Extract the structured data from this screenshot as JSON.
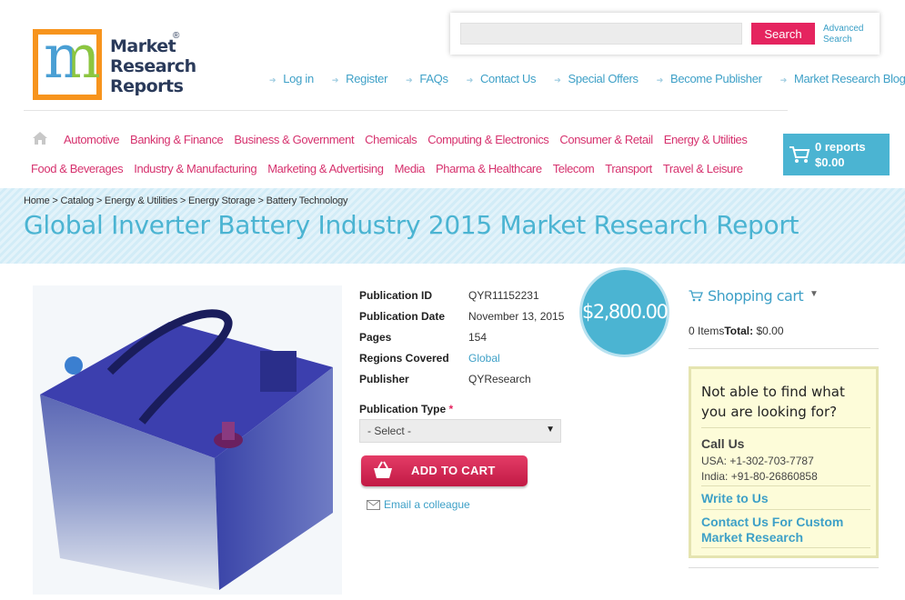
{
  "logo": {
    "line1": "Market",
    "line2": "Research",
    "line3": "Reports",
    "reg": "®",
    "letter": "m"
  },
  "search": {
    "placeholder": "",
    "button": "Search",
    "advanced": "Advanced Search"
  },
  "toplinks": [
    "Log in",
    "Register",
    "FAQs",
    "Contact Us",
    "Special Offers",
    "Become Publisher",
    "Market Research Blog"
  ],
  "categories_row1": [
    "Automotive",
    "Banking & Finance",
    "Business & Government",
    "Chemicals",
    "Computing & Electronics",
    "Consumer & Retail",
    "Energy & Utilities"
  ],
  "categories_row2": [
    "Food & Beverages",
    "Industry & Manufacturing",
    "Marketing & Advertising",
    "Media",
    "Pharma & Healthcare",
    "Telecom",
    "Transport",
    "Travel & Leisure"
  ],
  "cart": {
    "reports": "0 reports",
    "total": "$0.00"
  },
  "breadcrumb": "Home > Catalog > Energy & Utilities > Energy Storage > Battery Technology",
  "title": "Global Inverter Battery Industry 2015 Market Research Report",
  "details": {
    "rows": [
      {
        "label": "Publication ID",
        "value": "QYR11152231"
      },
      {
        "label": "Publication Date",
        "value": "November 13, 2015"
      },
      {
        "label": "Pages",
        "value": "154"
      },
      {
        "label": "Regions Covered",
        "value": "Global"
      },
      {
        "label": "Publisher",
        "value": "QYResearch"
      }
    ]
  },
  "price": "$2,800.00",
  "pubtype": {
    "label": "Publication Type",
    "required": "*",
    "selected": "- Select -"
  },
  "add_to_cart": "ADD TO CART",
  "email_colleague": "Email a colleague",
  "shopping_cart": {
    "title": "Shopping cart",
    "items": "0 Items",
    "total_label": "Total:",
    "total": "$0.00"
  },
  "help": {
    "title": "Not able to find what you are looking for?",
    "call_heading": "Call Us",
    "usa": "USA: +1-302-703-7787",
    "india": "India: +91-80-26860858",
    "write": "Write to Us",
    "custom": "Contact Us For Custom Market Research"
  },
  "colors": {
    "accent": "#4bb4d2",
    "pink": "#e5245f",
    "category": "#d6326e"
  }
}
